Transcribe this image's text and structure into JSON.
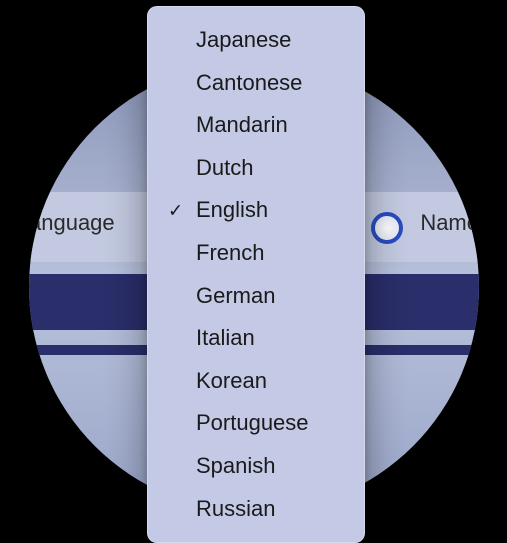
{
  "labels": {
    "left": "anguage",
    "right": "Name"
  },
  "dropdown": {
    "items": [
      {
        "label": "Japanese",
        "selected": false
      },
      {
        "label": "Cantonese",
        "selected": false
      },
      {
        "label": "Mandarin",
        "selected": false
      },
      {
        "label": "Dutch",
        "selected": false
      },
      {
        "label": "English",
        "selected": true
      },
      {
        "label": "French",
        "selected": false
      },
      {
        "label": "German",
        "selected": false
      },
      {
        "label": "Italian",
        "selected": false
      },
      {
        "label": "Korean",
        "selected": false
      },
      {
        "label": "Portuguese",
        "selected": false
      },
      {
        "label": "Spanish",
        "selected": false
      },
      {
        "label": "Russian",
        "selected": false
      }
    ]
  }
}
